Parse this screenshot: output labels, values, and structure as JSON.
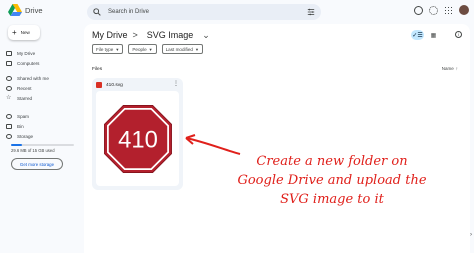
{
  "app": {
    "logo_text": "Drive",
    "search_placeholder": "Search in Drive"
  },
  "sidebar": {
    "new_label": "New",
    "items": [
      {
        "label": "My Drive"
      },
      {
        "label": "Computers"
      },
      {
        "label": "Shared with me"
      },
      {
        "label": "Recent"
      },
      {
        "label": "Starred"
      },
      {
        "label": "Spam"
      },
      {
        "label": "Bin"
      },
      {
        "label": "Storage"
      }
    ],
    "storage_text": "29.6 MB of 15 GB used",
    "storage_fraction": 0.18,
    "get_storage_label": "Get more storage"
  },
  "main": {
    "breadcrumb_root": "My Drive",
    "breadcrumb_sep": ">",
    "breadcrumb_current": "SVG Image",
    "filters": [
      "File type",
      "People",
      "Last modified"
    ],
    "section_title": "Files",
    "sort_label": "Name",
    "file": {
      "name": "410.svg",
      "thumb_text": "410"
    }
  },
  "annotation": {
    "lines": [
      "Create a new folder on",
      "Google Drive and upload the",
      "SVG image to it"
    ],
    "color": "#e0201b"
  },
  "colors": {
    "accent": "#0b57d0",
    "chip_active": "#c2e7ff",
    "stop_sign": "#b3202d"
  }
}
